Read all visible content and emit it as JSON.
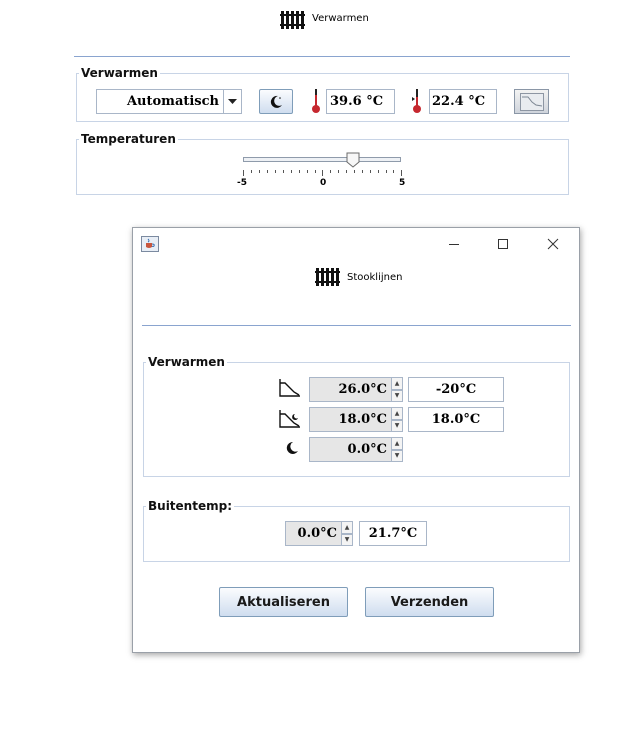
{
  "main": {
    "title": "Verwarmen",
    "verwarmen_group": {
      "legend": "Verwarmen",
      "mode_select": "Automatisch",
      "temp_1": "39.6 °C",
      "temp_2": "22.4 °C"
    },
    "temperaturen_group": {
      "legend": "Temperaturen",
      "slider_min": "-5",
      "slider_mid": "0",
      "slider_max": "5",
      "slider_value": 2
    }
  },
  "dialog": {
    "title": "Stooklijnen",
    "verwarmen_group": {
      "legend": "Verwarmen",
      "row1_spin": "26.0°C",
      "row1_field": "-20°C",
      "row2_spin": "18.0°C",
      "row2_field": "18.0°C",
      "row3_spin": "0.0°C"
    },
    "buitentemp_group": {
      "legend": "Buitentemp:",
      "spin": "0.0°C",
      "field": "21.7°C"
    },
    "buttons": {
      "refresh": "Aktualiseren",
      "send": "Verzenden"
    }
  },
  "icons": {
    "radiator": "radiator-icon",
    "moon": "moon-icon",
    "thermometer": "thermometer-icon",
    "graph": "graph-icon",
    "heating_curve": "heating-curve-icon",
    "java": "java-icon"
  }
}
